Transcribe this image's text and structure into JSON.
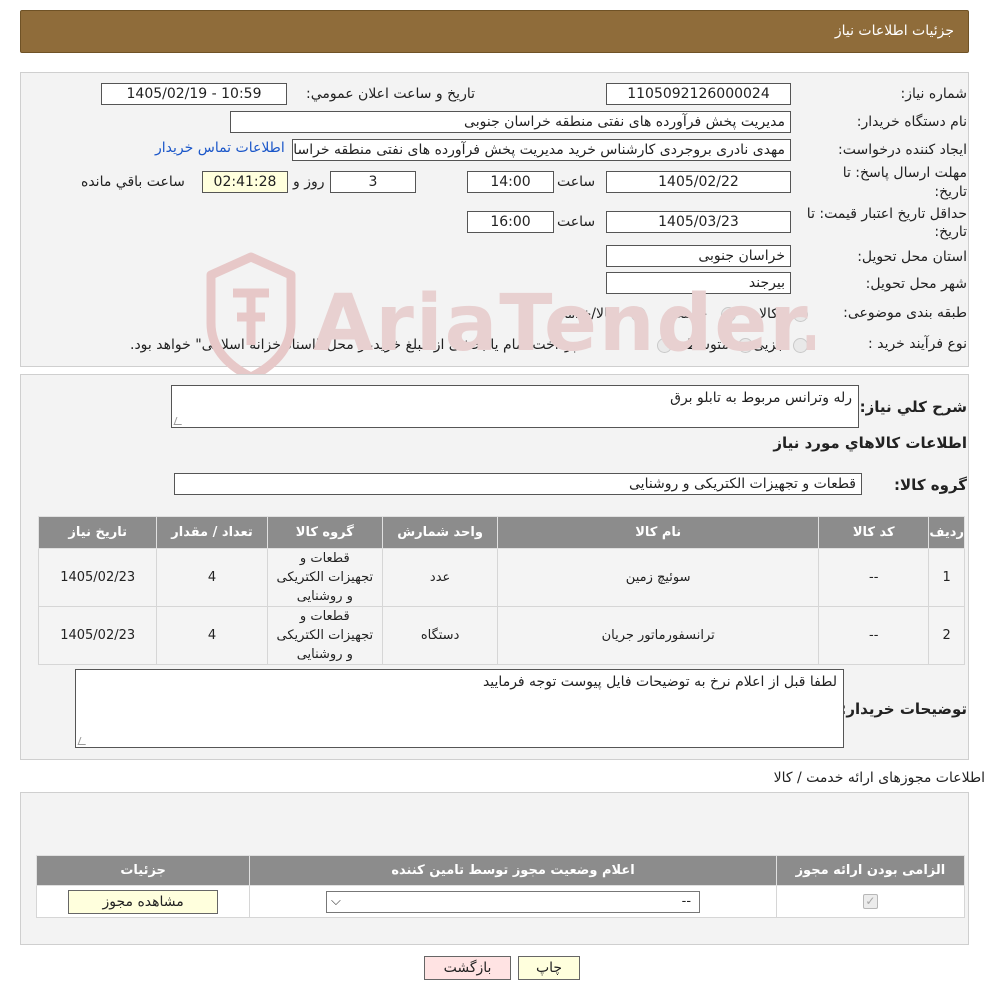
{
  "header": {
    "title": "جزئیات اطلاعات نیاز"
  },
  "form": {
    "need_number_label": "شماره نیاز:",
    "need_number": "1105092126000024",
    "announce_label": "تاریخ و ساعت اعلان عمومي:",
    "announce_value": "1405/02/19 - 10:59",
    "buyer_label": "نام دستگاه خریدار:",
    "buyer_value": "مدیریت پخش فرآورده های نفتی منطقه خراسان جنوبی",
    "creator_label": "ایجاد کننده درخواست:",
    "creator_value": "مهدی نادری بروجردی کارشناس خرید مدیریت پخش فرآورده های نفتی منطقه خراسان جنوبی",
    "contact_link": "اطلاعات تماس خریدار",
    "deadline_label_1": "مهلت ارسال پاسخ: تا",
    "deadline_label_2": "تاریخ:",
    "deadline_date": "1405/02/22",
    "time_label": "ساعت",
    "deadline_time": "14:00",
    "days_value": "3",
    "days_label": "روز و",
    "remaining_value": "02:41:28",
    "remaining_label": "ساعت باقي مانده",
    "validity_label_1": "حداقل تاریخ اعتبار قیمت: تا",
    "validity_label_2": "تاریخ:",
    "validity_date": "1405/03/23",
    "validity_time": "16:00",
    "province_label": "استان محل تحویل:",
    "province_value": "خراسان جنوبی",
    "city_label": "شهر محل تحویل:",
    "city_value": "بیرجند",
    "category_label": "طبقه بندی موضوعی:",
    "cat_opt_1": "کالا",
    "cat_opt_2": "خدمت",
    "cat_opt_3": "کالا/خدمت",
    "process_label": "نوع فرآیند خرید :",
    "proc_opt_1": "جزیی",
    "proc_opt_2": "متوسط",
    "proc_note": "پرداخت تمام یا بخشی از مبلغ خرید،از محل \"اسناد خزانه اسلامی\" خواهد بود."
  },
  "watermark": "AriaTender.neT",
  "description": {
    "label": "شرح كلي نياز:",
    "value": "رله وترانس مربوط به تابلو برق"
  },
  "goods": {
    "section_title": "اطلاعات كالاهاي مورد نياز",
    "group_label": "گروه كالا:",
    "group_value": "قطعات و تجهیزات الکتریکی و روشنایی",
    "columns": [
      "رديف",
      "کد کالا",
      "نام کالا",
      "واحد شمارش",
      "گروه کالا",
      "تعداد / مقدار",
      "تاریخ نیاز"
    ],
    "rows": [
      {
        "row": "1",
        "code": "--",
        "name": "سوئیچ زمین",
        "unit": "عدد",
        "group": "قطعات و تجهیزات الکتریکی و روشنایی",
        "qty": "4",
        "date": "1405/02/23"
      },
      {
        "row": "2",
        "code": "--",
        "name": "ترانسفورماتور جریان",
        "unit": "دستگاه",
        "group": "قطعات و تجهیزات الکتریکی و روشنایی",
        "qty": "4",
        "date": "1405/02/23"
      }
    ]
  },
  "buyer_notes": {
    "label": "توضیحات خریدار:",
    "value": "لطفا قبل از اعلام نرخ به توضیحات فایل پیوست توجه فرمایید"
  },
  "permits": {
    "section_title": "اطلاعات مجوزهای ارائه خدمت / کالا",
    "columns": [
      "الزامی بودن ارائه مجوز",
      "اعلام وضعیت مجوز توسط تامین کننده",
      "جزئیات"
    ],
    "select_value": "--",
    "view_button": "مشاهده مجوز"
  },
  "actions": {
    "print": "چاپ",
    "back": "بازگشت"
  }
}
